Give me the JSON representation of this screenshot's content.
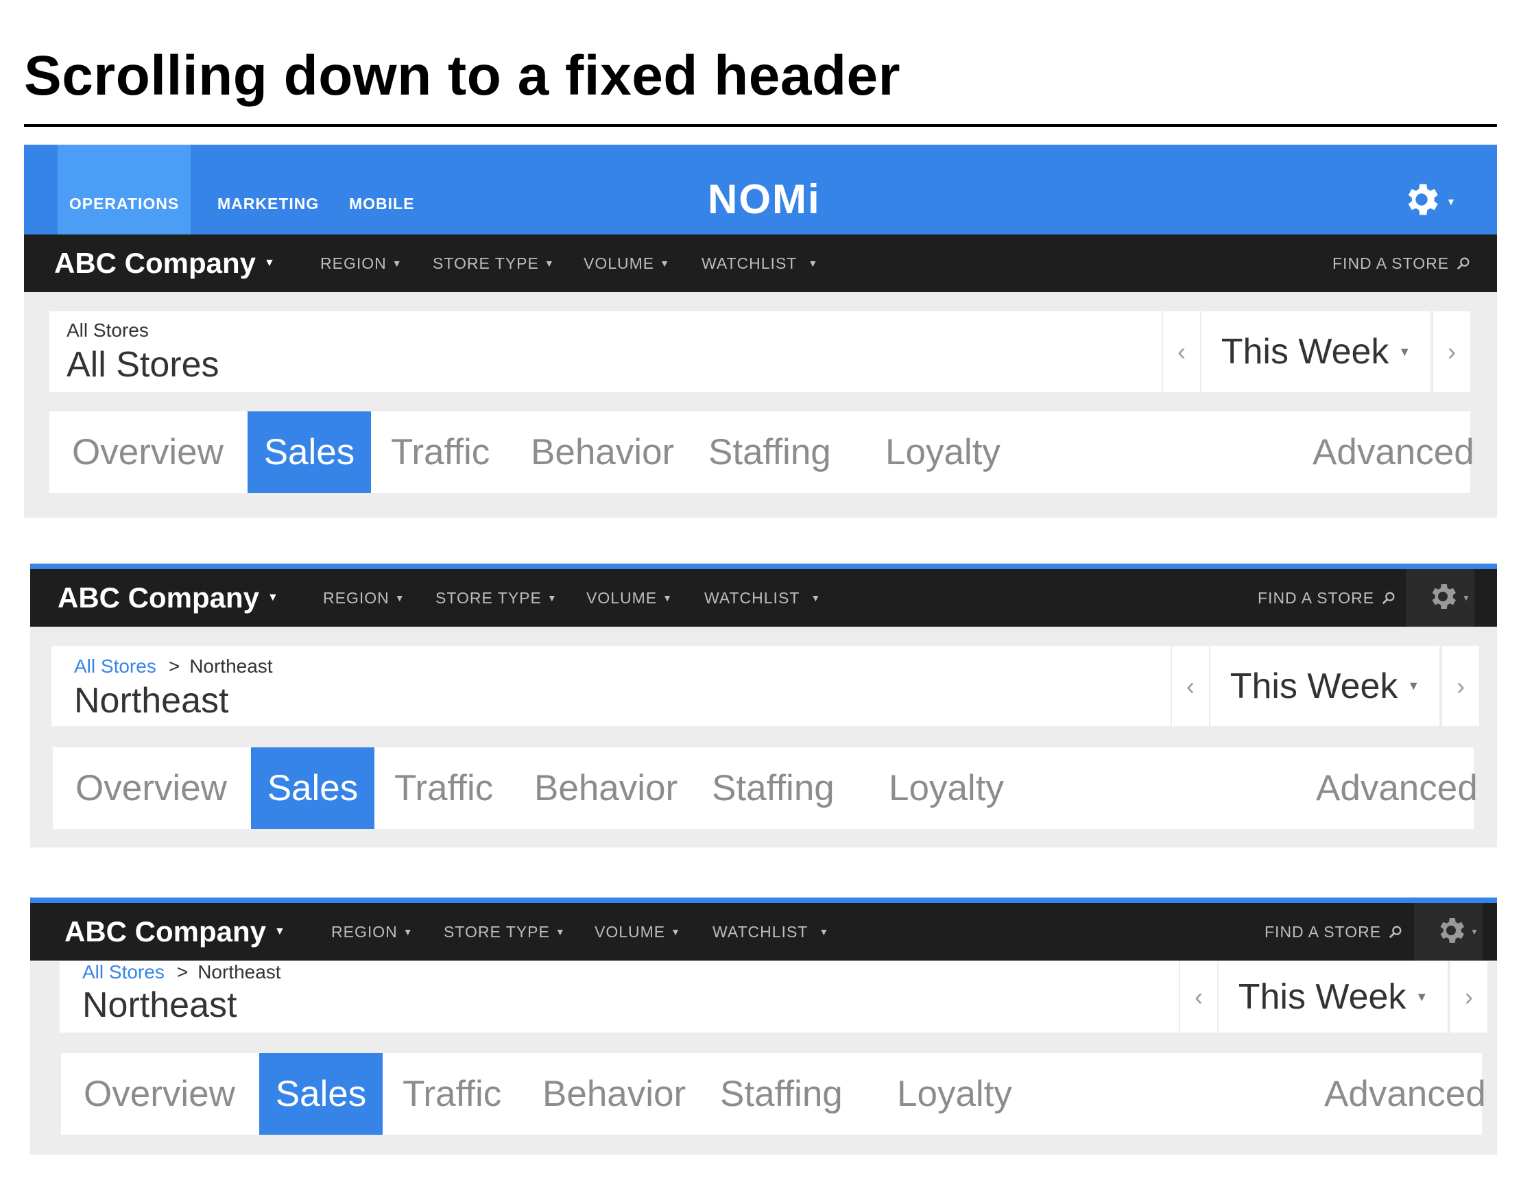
{
  "page_title": "Scrolling down to a fixed header",
  "colors": {
    "accent": "#3784e8",
    "dark_bar": "#1e1e1e",
    "panel_bg": "#ededed",
    "active_nav": "#4b9df5"
  },
  "topnav": {
    "items": [
      {
        "label": "OPERATIONS",
        "active": true
      },
      {
        "label": "MARKETING"
      },
      {
        "label": "MOBILE"
      }
    ],
    "logo": "NOMi",
    "settings_icon": "gear-icon"
  },
  "filterbar": {
    "company": "ABC Company",
    "filters": [
      {
        "label": "REGION"
      },
      {
        "label": "STORE TYPE"
      },
      {
        "label": "VOLUME"
      },
      {
        "label": "WATCHLIST"
      }
    ],
    "find_label": "FIND A STORE",
    "search_icon": "search-icon"
  },
  "date": {
    "range": "This Week",
    "prev_icon": "chevron-left-icon",
    "next_icon": "chevron-right-icon"
  },
  "tabs": [
    {
      "label": "Overview"
    },
    {
      "label": "Sales",
      "active": true
    },
    {
      "label": "Traffic"
    },
    {
      "label": "Behavior"
    },
    {
      "label": "Staffing"
    },
    {
      "label": "Loyalty"
    },
    {
      "label": "Advanced"
    }
  ],
  "states": [
    {
      "crumb": "All Stores",
      "store": "All Stores"
    },
    {
      "crumb_link": "All Stores",
      "crumb_sep": ">",
      "crumb_current": "Northeast",
      "store": "Northeast"
    },
    {
      "crumb_link": "All Stores",
      "crumb_sep": ">",
      "crumb_current": "Northeast",
      "store": "Northeast"
    }
  ]
}
